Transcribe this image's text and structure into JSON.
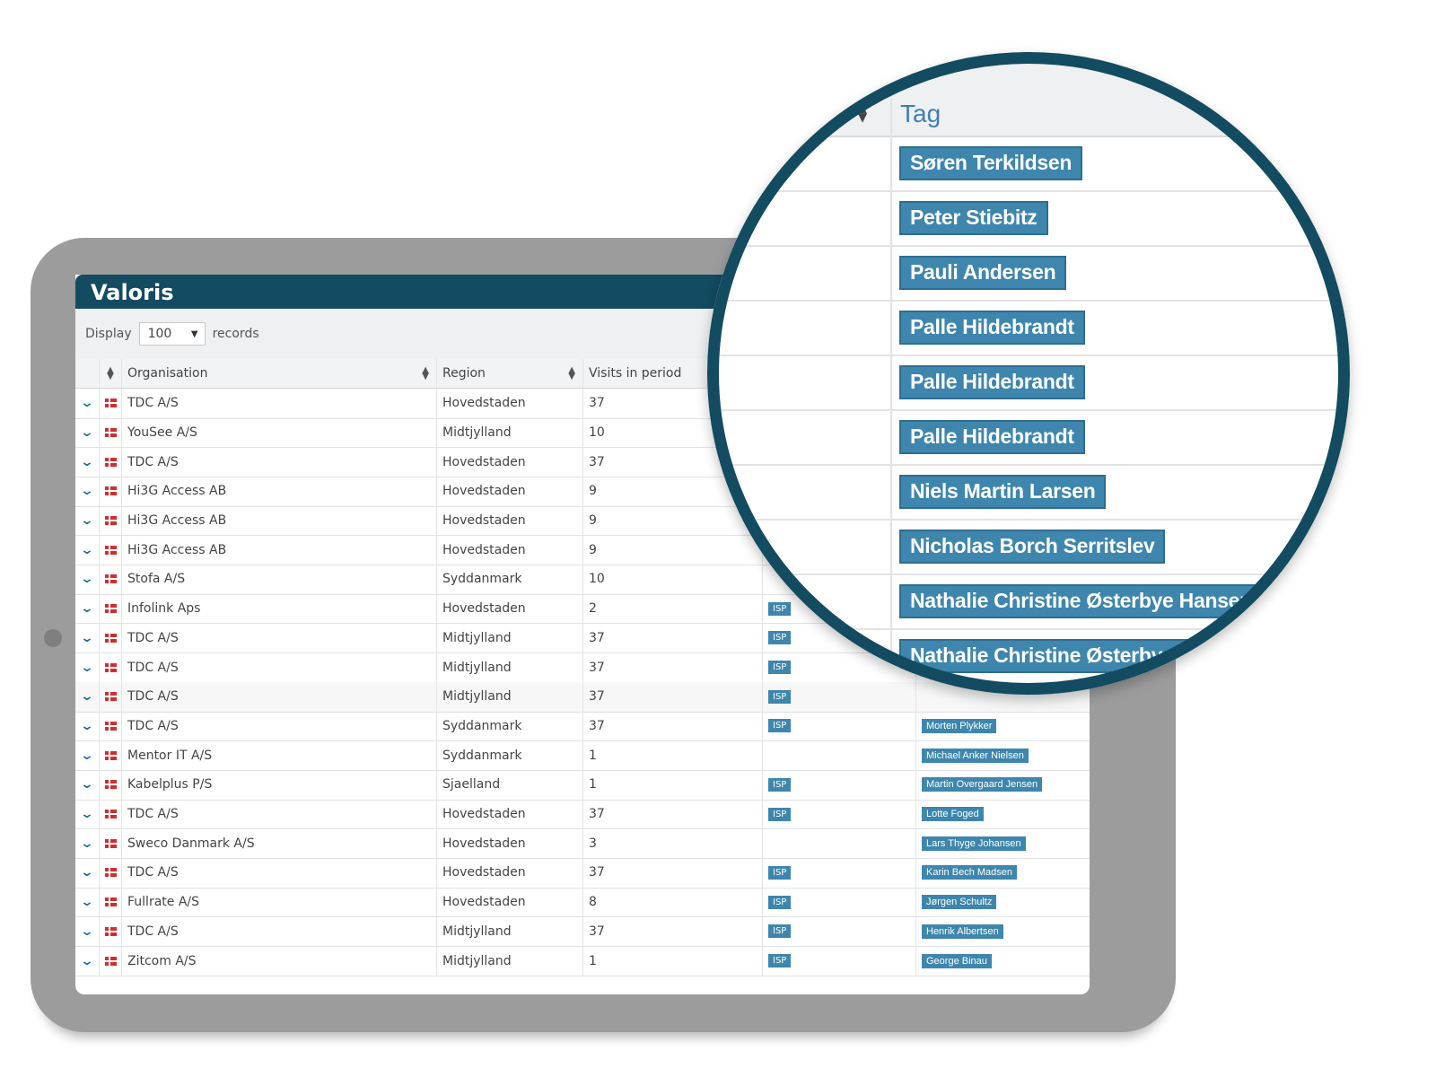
{
  "app": {
    "title": "Valoris"
  },
  "toolbar": {
    "display_label": "Display",
    "records_value": "100",
    "records_label": "records"
  },
  "table": {
    "columns": [
      "Organisation",
      "Region",
      "Visits in period"
    ],
    "rows": [
      {
        "org": "TDC A/S",
        "region": "Hovedstaden",
        "visits": "37",
        "badge": "",
        "tag": ""
      },
      {
        "org": "YouSee A/S",
        "region": "Midtjylland",
        "visits": "10",
        "badge": "",
        "tag": ""
      },
      {
        "org": "TDC A/S",
        "region": "Hovedstaden",
        "visits": "37",
        "badge": "",
        "tag": ""
      },
      {
        "org": "Hi3G Access AB",
        "region": "Hovedstaden",
        "visits": "9",
        "badge": "",
        "tag": ""
      },
      {
        "org": "Hi3G Access AB",
        "region": "Hovedstaden",
        "visits": "9",
        "badge": "",
        "tag": ""
      },
      {
        "org": "Hi3G Access AB",
        "region": "Hovedstaden",
        "visits": "9",
        "badge": "",
        "tag": ""
      },
      {
        "org": "Stofa A/S",
        "region": "Syddanmark",
        "visits": "10",
        "badge": "",
        "tag": ""
      },
      {
        "org": "Infolink Aps",
        "region": "Hovedstaden",
        "visits": "2",
        "badge": "ISP",
        "tag": ""
      },
      {
        "org": "TDC A/S",
        "region": "Midtjylland",
        "visits": "37",
        "badge": "ISP",
        "tag": ""
      },
      {
        "org": "TDC A/S",
        "region": "Midtjylland",
        "visits": "37",
        "badge": "ISP",
        "tag": ""
      },
      {
        "org": "TDC A/S",
        "region": "Midtjylland",
        "visits": "37",
        "badge": "ISP",
        "tag": ""
      },
      {
        "org": "TDC A/S",
        "region": "Syddanmark",
        "visits": "37",
        "badge": "ISP",
        "tag": "Morten Plykker"
      },
      {
        "org": "Mentor IT A/S",
        "region": "Syddanmark",
        "visits": "1",
        "badge": "",
        "tag": "Michael Anker Nielsen"
      },
      {
        "org": "Kabelplus P/S",
        "region": "Sjaelland",
        "visits": "1",
        "badge": "ISP",
        "tag": "Martin Overgaard Jensen"
      },
      {
        "org": "TDC A/S",
        "region": "Hovedstaden",
        "visits": "37",
        "badge": "ISP",
        "tag": "Lotte Foged"
      },
      {
        "org": "Sweco Danmark A/S",
        "region": "Hovedstaden",
        "visits": "3",
        "badge": "",
        "tag": "Lars Thyge Johansen"
      },
      {
        "org": "TDC A/S",
        "region": "Hovedstaden",
        "visits": "37",
        "badge": "ISP",
        "tag": "Karin Bech Madsen"
      },
      {
        "org": "Fullrate A/S",
        "region": "Hovedstaden",
        "visits": "8",
        "badge": "ISP",
        "tag": "Jørgen Schultz"
      },
      {
        "org": "TDC A/S",
        "region": "Midtjylland",
        "visits": "37",
        "badge": "ISP",
        "tag": "Henrik Albertsen"
      },
      {
        "org": "Zitcom A/S",
        "region": "Midtjylland",
        "visits": "1",
        "badge": "ISP",
        "tag": "George Binau"
      }
    ]
  },
  "magnifier": {
    "column_header": "Tag",
    "tags": [
      "Søren Terkildsen",
      "Peter Stiebitz",
      "Pauli Andersen",
      "Palle Hildebrandt",
      "Palle Hildebrandt",
      "Palle Hildebrandt",
      "Niels Martin Larsen",
      "Nicholas Borch Serritslev",
      "Nathalie Christine Østerbye Hansen",
      "Nathalie Christine Østerbye H"
    ]
  },
  "icons": {
    "expand": "chevron-down-icon",
    "flag": "denmark-flag-icon",
    "sort": "sort-icon"
  },
  "colors": {
    "brand": "#134b60",
    "tag": "#3e86ad",
    "chevron": "#1a6fa0"
  }
}
